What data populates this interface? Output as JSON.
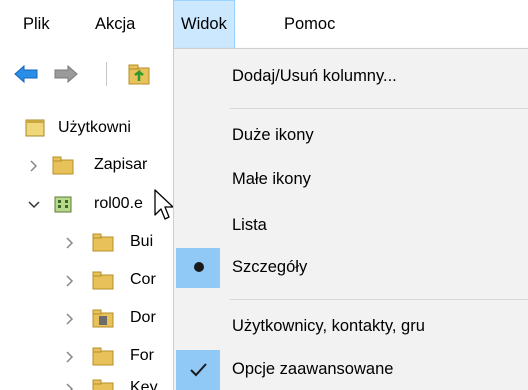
{
  "menubar": {
    "items": [
      "Plik",
      "Akcja",
      "Widok",
      "Pomoc"
    ],
    "active": "Widok"
  },
  "toolbar": {
    "back_icon": "back-arrow-icon",
    "forward_icon": "forward-arrow-icon",
    "up_folder_icon": "up-folder-icon"
  },
  "tree": {
    "root": "Użytkowni",
    "saved": "Zapisar",
    "domain": "rol00.e",
    "children": [
      "Bui",
      "Cor",
      "Dor",
      "For",
      "Key"
    ]
  },
  "view_menu": {
    "add_remove_columns": "Dodaj/Usuń kolumny...",
    "large_icons": "Duże ikony",
    "small_icons": "Małe ikony",
    "list": "Lista",
    "details": "Szczegóły",
    "users_contacts": "Użytkownicy, kontakty, gru",
    "advanced_options": "Opcje zaawansowane"
  },
  "colors": {
    "menu_highlight": "#cce8ff",
    "check_background": "#90c8f6",
    "menu_background": "#f2f2f2",
    "folder": "#e8c15a"
  }
}
